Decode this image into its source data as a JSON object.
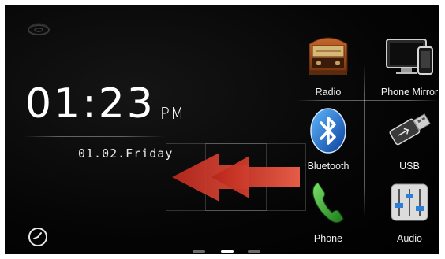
{
  "clock": {
    "time": "01:23",
    "ampm": "PM",
    "date": "01.02.Friday"
  },
  "apps": [
    {
      "label": "Radio",
      "icon": "radio-icon"
    },
    {
      "label": "Phone Mirror",
      "icon": "phone-mirror-icon"
    },
    {
      "label": "Bluetooth",
      "icon": "bluetooth-icon"
    },
    {
      "label": "USB",
      "icon": "usb-icon"
    },
    {
      "label": "Phone",
      "icon": "phone-icon"
    },
    {
      "label": "Audio",
      "icon": "audio-icon"
    }
  ],
  "pager": {
    "pages": 3,
    "current": 2
  },
  "colors": {
    "background": "#000000",
    "text": "#ffffff",
    "swipe_arrow": "#d8382a",
    "pager_active": "#ffffff",
    "pager_inactive": "#6a6a6a"
  }
}
